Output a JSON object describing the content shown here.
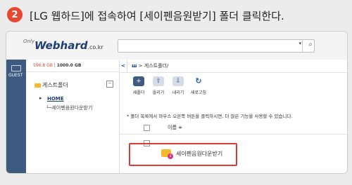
{
  "step": {
    "number": "2",
    "instruction": "[LG 웹하드]에 접속하여 [세이펜음원받기] 폴더 클릭한다."
  },
  "header": {
    "logo_only": "Only",
    "logo_main": "Webhard",
    "logo_suffix": ".co.kr",
    "search_dropdown_icon": "▾",
    "search_icon_glyph": "⌕"
  },
  "left_strip": {
    "guest_label": "GUEST"
  },
  "sidebar": {
    "quota_used": "596.8 GB",
    "quota_separator": " | ",
    "quota_total": "1000.0 GB",
    "root_folder": "게스트폴더",
    "collapse_symbol": "−",
    "home_label": "HOME",
    "child_folder": "세이펜음원다운받기"
  },
  "breadcrumb": {
    "back_symbol": "<",
    "home_symbol": "ш",
    "separator": " > ",
    "path": "게스트폴더/"
  },
  "toolbar": {
    "buttons": [
      {
        "label": "새폴더",
        "icon": "folder-plus-icon",
        "glyph": "+",
        "color": "#3d5a80"
      },
      {
        "label": "올리기",
        "icon": "upload-icon",
        "glyph": "⇧",
        "color": "#d7dde6"
      },
      {
        "label": "내리기",
        "icon": "download-icon",
        "glyph": "⇩",
        "color": "#d7dde6"
      },
      {
        "label": "새로고침",
        "icon": "refresh-icon",
        "glyph": "↻",
        "color": "#ffffff"
      }
    ]
  },
  "notice": "* 폴더 목록에서 마우스 오른쪽 버튼을 클릭하시면, 더 많은 기능을 사용할 수 있습니다.",
  "list": {
    "header_name": "이름 ≑",
    "rows": [
      {
        "name": "세이펜음원다운받기"
      }
    ]
  },
  "colors": {
    "accent_red": "#e8472f",
    "highlight": "#e03a35",
    "brand_blue": "#1d3f72",
    "folder_yellow": "#f5b72b"
  }
}
